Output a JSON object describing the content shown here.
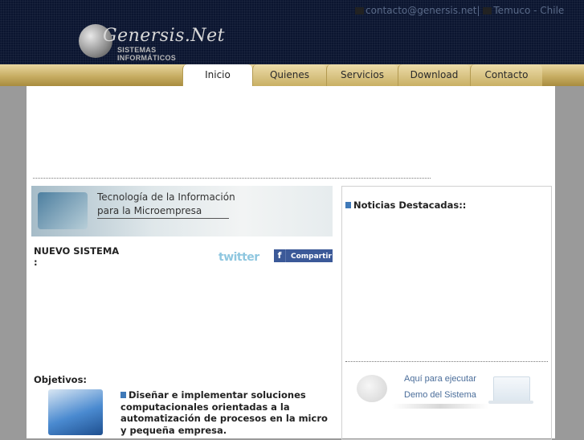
{
  "header": {
    "logo_name": "Genersis.Net",
    "logo_sub": "SISTEMAS INFORMÁTICOS",
    "contact_email": "contacto@genersis.net",
    "separator": "|",
    "location": "Temuco - Chile"
  },
  "nav": {
    "tabs": [
      {
        "label": "Inicio"
      },
      {
        "label": "Quienes somos"
      },
      {
        "label": "Servicios"
      },
      {
        "label": "Download"
      },
      {
        "label": "Contacto"
      }
    ],
    "active": "Inicio"
  },
  "banner": {
    "line1": "Tecnología de la Información",
    "line2": "para la Microempresa"
  },
  "section": {
    "nuevo_sistema": "NUEVO SISTEMA",
    "colon": ":",
    "twitter": "twitter",
    "share_f": "f",
    "share_label": "Compartir",
    "objetivos": "Objetivos:",
    "objetivo_text": "Diseñar e implementar soluciones computacionales orientadas a la automatización de procesos en la micro y pequeña empresa."
  },
  "sidebar": {
    "news_title": "Noticias Destacadas::",
    "demo_line1": "Aquí para ejecutar",
    "demo_line2": "Demo del Sistema"
  },
  "colors": {
    "header_bg": "#0b1530",
    "nav_gold": "#c7ad63",
    "page_gray": "#9a9a9a",
    "link_blue": "#4a6d9a"
  }
}
